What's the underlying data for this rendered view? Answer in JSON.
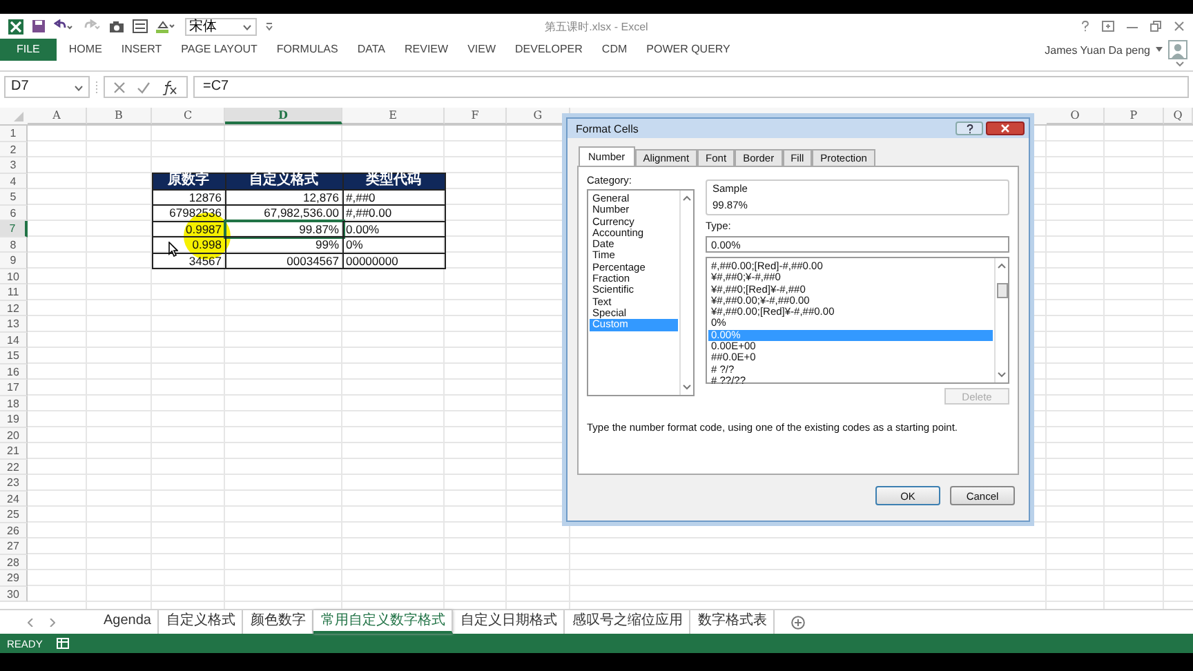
{
  "title_bar": {
    "font_box": "宋体",
    "title": "第五课时.xlsx - Excel"
  },
  "ribbon": {
    "tabs": [
      {
        "label": "FILE",
        "kind": "file"
      },
      {
        "label": "HOME",
        "kind": "tab"
      },
      {
        "label": "INSERT",
        "kind": "tab"
      },
      {
        "label": "PAGE LAYOUT",
        "kind": "tab"
      },
      {
        "label": "FORMULAS",
        "kind": "tab"
      },
      {
        "label": "DATA",
        "kind": "tab"
      },
      {
        "label": "REVIEW",
        "kind": "tab"
      },
      {
        "label": "VIEW",
        "kind": "tab"
      },
      {
        "label": "DEVELOPER",
        "kind": "tab"
      },
      {
        "label": "CDM",
        "kind": "tab"
      },
      {
        "label": "POWER QUERY",
        "kind": "tab"
      }
    ],
    "user": "James Yuan Da peng"
  },
  "formula_bar": {
    "name_box": "D7",
    "formula": "=C7"
  },
  "columns_left": [
    {
      "letter": "A",
      "selected": false
    },
    {
      "letter": "B",
      "selected": false
    },
    {
      "letter": "C",
      "selected": false
    },
    {
      "letter": "D",
      "selected": true
    },
    {
      "letter": "E",
      "selected": false
    },
    {
      "letter": "F",
      "selected": false
    },
    {
      "letter": "G",
      "selected": false
    }
  ],
  "columns_right": [
    {
      "letter": "O",
      "selected": false
    },
    {
      "letter": "P",
      "selected": false
    },
    {
      "letter": "Q",
      "selected": false
    }
  ],
  "rows": [
    {
      "number": "1",
      "selected": false
    },
    {
      "number": "2",
      "selected": false
    },
    {
      "number": "3",
      "selected": false
    },
    {
      "number": "4",
      "selected": false,
      "kind": "header",
      "cells": [
        {
          "text": "原数字",
          "selected": false
        },
        {
          "text": "自定义格式",
          "selected": false
        },
        {
          "text": "类型代码",
          "selected": false
        }
      ]
    },
    {
      "number": "5",
      "selected": false,
      "kind": "data",
      "cells": [
        {
          "text": "12876",
          "selected": false
        },
        {
          "text": "12,876",
          "selected": false
        },
        {
          "text": "#,##0",
          "selected": false
        }
      ]
    },
    {
      "number": "6",
      "selected": false,
      "kind": "data",
      "cells": [
        {
          "text": "67982536",
          "selected": false
        },
        {
          "text": "67,982,536.00",
          "selected": false
        },
        {
          "text": "#,##0.00",
          "selected": false
        }
      ]
    },
    {
      "number": "7",
      "selected": true,
      "kind": "data",
      "cells": [
        {
          "text": "0.9987",
          "selected": false
        },
        {
          "text": "99.87%",
          "selected": true
        },
        {
          "text": "0.00%",
          "selected": false
        }
      ]
    },
    {
      "number": "8",
      "selected": false,
      "kind": "data",
      "cells": [
        {
          "text": "0.998",
          "selected": false
        },
        {
          "text": "99%",
          "selected": false
        },
        {
          "text": "0%",
          "selected": false
        }
      ]
    },
    {
      "number": "9",
      "selected": false,
      "kind": "data",
      "cells": [
        {
          "text": "34567",
          "selected": false
        },
        {
          "text": "00034567",
          "selected": false
        },
        {
          "text": "00000000",
          "selected": false
        }
      ]
    },
    {
      "number": "10",
      "selected": false
    },
    {
      "number": "11",
      "selected": false
    },
    {
      "number": "12",
      "selected": false
    },
    {
      "number": "13",
      "selected": false
    },
    {
      "number": "14",
      "selected": false
    },
    {
      "number": "15",
      "selected": false
    },
    {
      "number": "16",
      "selected": false
    },
    {
      "number": "17",
      "selected": false
    },
    {
      "number": "18",
      "selected": false
    },
    {
      "number": "19",
      "selected": false
    },
    {
      "number": "20",
      "selected": false
    },
    {
      "number": "21",
      "selected": false
    },
    {
      "number": "22",
      "selected": false
    },
    {
      "number": "23",
      "selected": false
    },
    {
      "number": "24",
      "selected": false
    },
    {
      "number": "25",
      "selected": false
    },
    {
      "number": "26",
      "selected": false
    },
    {
      "number": "27",
      "selected": false
    },
    {
      "number": "28",
      "selected": false
    },
    {
      "number": "29",
      "selected": false
    },
    {
      "number": "30",
      "selected": false
    }
  ],
  "sheet_tabs": [
    {
      "label": "Agenda",
      "selected": false
    },
    {
      "label": "自定义格式",
      "selected": false
    },
    {
      "label": "颜色数字",
      "selected": false
    },
    {
      "label": "常用自定义数字格式",
      "selected": true
    },
    {
      "label": "自定义日期格式",
      "selected": false
    },
    {
      "label": "感叹号之缩位应用",
      "selected": false
    },
    {
      "label": "数字格式表",
      "selected": false
    }
  ],
  "status_bar": {
    "text": "READY"
  },
  "dialog": {
    "title": "Format Cells",
    "tabs": [
      {
        "label": "Number",
        "selected": true
      },
      {
        "label": "Alignment",
        "selected": false
      },
      {
        "label": "Font",
        "selected": false
      },
      {
        "label": "Border",
        "selected": false
      },
      {
        "label": "Fill",
        "selected": false
      },
      {
        "label": "Protection",
        "selected": false
      }
    ],
    "category_label": "Category:",
    "categories": [
      {
        "label": "General",
        "selected": false
      },
      {
        "label": "Number",
        "selected": false
      },
      {
        "label": "Currency",
        "selected": false
      },
      {
        "label": "Accounting",
        "selected": false
      },
      {
        "label": "Date",
        "selected": false
      },
      {
        "label": "Time",
        "selected": false
      },
      {
        "label": "Percentage",
        "selected": false
      },
      {
        "label": "Fraction",
        "selected": false
      },
      {
        "label": "Scientific",
        "selected": false
      },
      {
        "label": "Text",
        "selected": false
      },
      {
        "label": "Special",
        "selected": false
      },
      {
        "label": "Custom",
        "selected": true
      }
    ],
    "sample_label": "Sample",
    "sample": "99.87%",
    "type_label": "Type:",
    "type_value": "0.00%",
    "formats": [
      {
        "label": "#,##0.00;[Red]-#,##0.00",
        "selected": false
      },
      {
        "label": "¥#,##0;¥-#,##0",
        "selected": false
      },
      {
        "label": "¥#,##0;[Red]¥-#,##0",
        "selected": false
      },
      {
        "label": "¥#,##0.00;¥-#,##0.00",
        "selected": false
      },
      {
        "label": "¥#,##0.00;[Red]¥-#,##0.00",
        "selected": false
      },
      {
        "label": "0%",
        "selected": false
      },
      {
        "label": "0.00%",
        "selected": true
      },
      {
        "label": "0.00E+00",
        "selected": false
      },
      {
        "label": "##0.0E+0",
        "selected": false
      },
      {
        "label": "# ?/?",
        "selected": false
      },
      {
        "label": "# ??/??",
        "selected": false
      }
    ],
    "delete_button": {
      "label": "Delete",
      "disabled": true
    },
    "description": "Type the number format code, using one of the existing codes as a starting point.",
    "buttons": [
      "OK",
      "Cancel"
    ]
  }
}
